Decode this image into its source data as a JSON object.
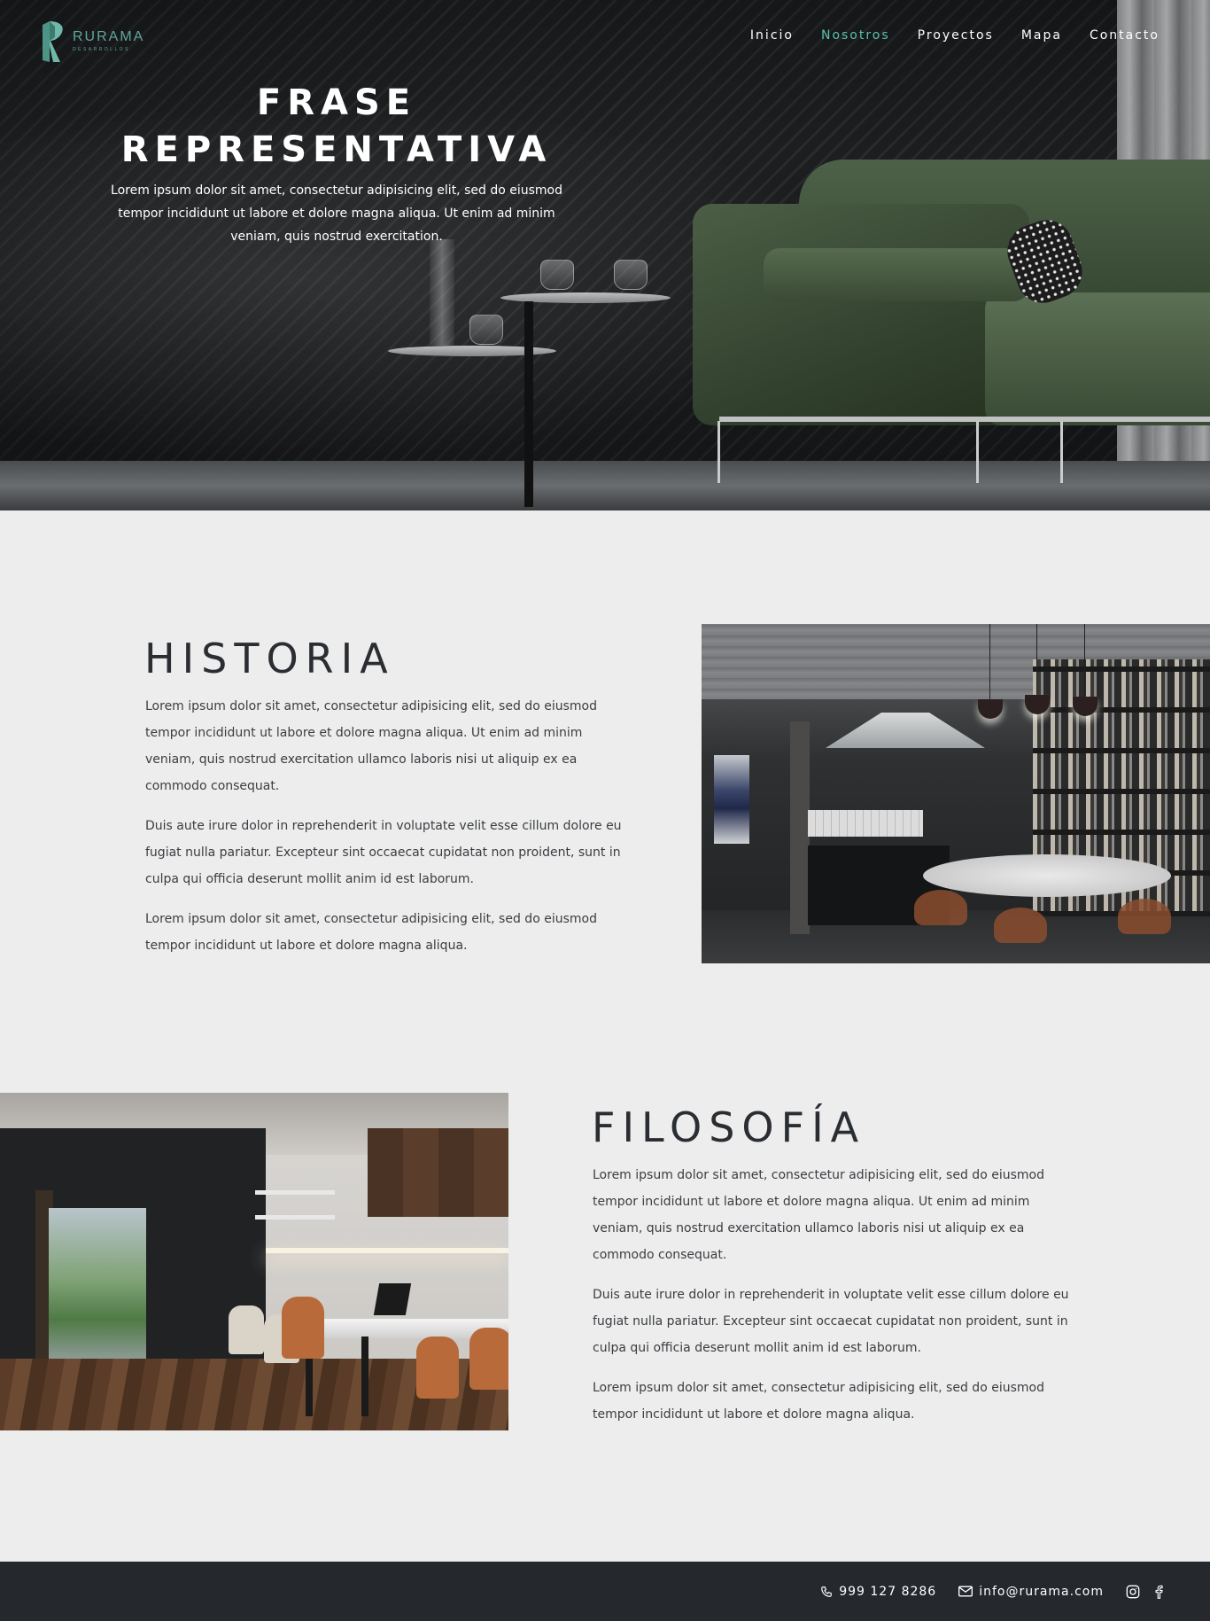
{
  "brand": {
    "name": "RURAMA",
    "subtitle": "DESARROLLOS",
    "accent_color": "#5fa89b"
  },
  "nav": {
    "items": [
      {
        "label": "Inicio",
        "active": false
      },
      {
        "label": "Nosotros",
        "active": true
      },
      {
        "label": "Proyectos",
        "active": false
      },
      {
        "label": "Mapa",
        "active": false
      },
      {
        "label": "Contacto",
        "active": false
      }
    ],
    "active_color": "#5cc0b0"
  },
  "hero": {
    "title_line1": "FRASE",
    "title_line2": "REPRESENTATIVA",
    "text": "Lorem ipsum dolor sit amet, consectetur adipisicing elit, sed do eiusmod tempor incididunt ut labore et dolore magna aliqua. Ut enim ad minim veniam, quis nostrud exercitation."
  },
  "historia": {
    "title": "HISTORIA",
    "paragraphs": [
      "Lorem ipsum dolor sit amet, consectetur adipisicing elit, sed do eiusmod tempor incididunt ut labore et dolore magna aliqua. Ut enim ad minim veniam, quis nostrud exercitation ullamco laboris nisi ut aliquip ex ea commodo consequat.",
      "Duis aute irure dolor in reprehenderit in voluptate velit esse cillum dolore eu fugiat nulla pariatur. Excepteur sint occaecat cupidatat non proident, sunt in culpa qui officia deserunt mollit anim id est laborum.",
      "Lorem ipsum dolor sit amet, consectetur adipisicing elit, sed do eiusmod tempor incididunt ut labore et dolore magna aliqua."
    ]
  },
  "filosofia": {
    "title": "FILOSOFÍA",
    "paragraphs": [
      "Lorem ipsum dolor sit amet, consectetur adipisicing elit, sed do eiusmod tempor incididunt ut labore et dolore magna aliqua. Ut enim ad minim veniam, quis nostrud exercitation ullamco laboris nisi ut aliquip ex ea commodo consequat.",
      "Duis aute irure dolor in reprehenderit in voluptate velit esse cillum dolore eu fugiat nulla pariatur. Excepteur sint occaecat cupidatat non proident, sunt in culpa qui officia deserunt mollit anim id est laborum.",
      "Lorem ipsum dolor sit amet, consectetur adipisicing elit, sed do eiusmod tempor incididunt ut labore et dolore magna aliqua."
    ]
  },
  "footer": {
    "phone": "999 127 8286",
    "email": "info@rurama.com",
    "icons": [
      "phone-icon",
      "mail-icon",
      "instagram-icon",
      "facebook-icon"
    ],
    "background": "#25282c"
  }
}
